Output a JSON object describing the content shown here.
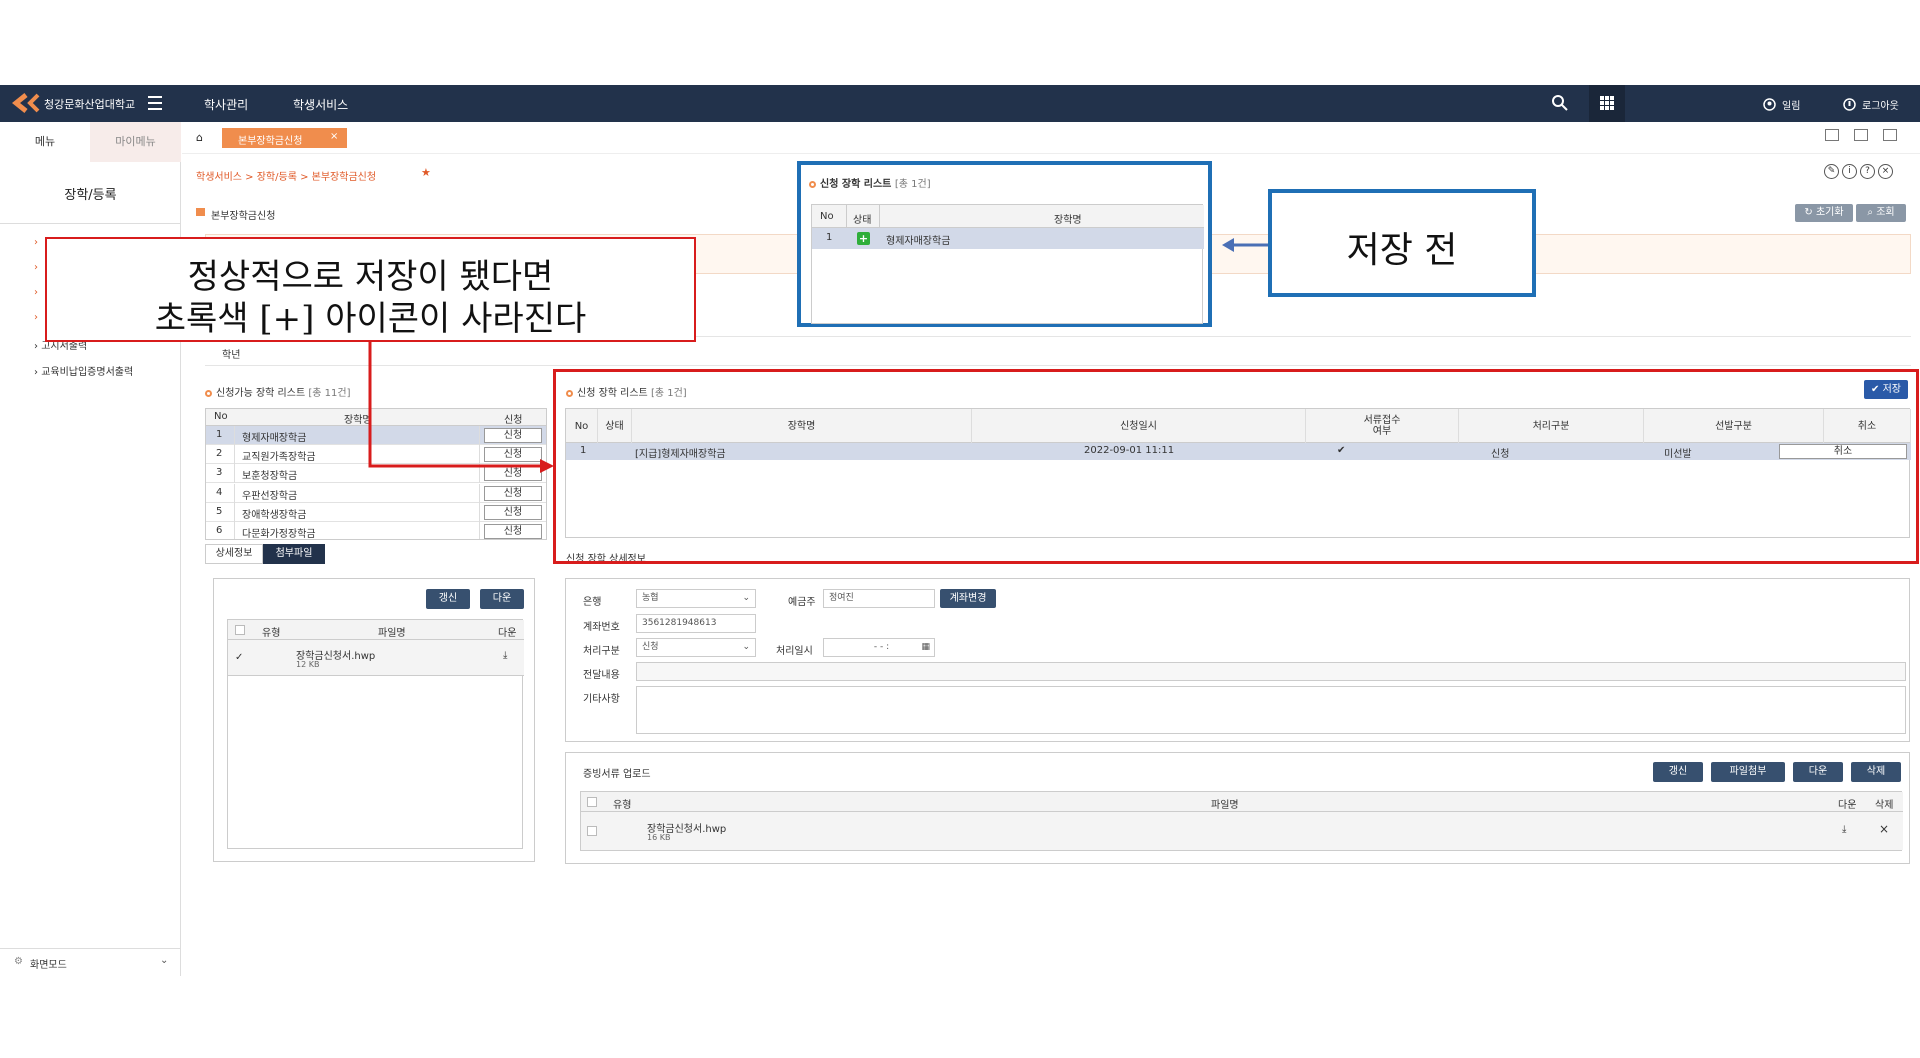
{
  "topbar": {
    "logo_text": "청강문화산업대학교",
    "menu1": "학사관리",
    "menu2": "학생서비스",
    "user": "일림",
    "logout": "로그아웃"
  },
  "sidebar": {
    "tab_menu": "메뉴",
    "tab_mymenu": "마이메뉴",
    "section_title": "장학/등록",
    "items": [
      "고지서출력",
      "교육비납입증명서출력"
    ],
    "screen_mode": "화면모드"
  },
  "main": {
    "active_tab": "본부장학금신청",
    "breadcrumb": "학생서비스 > 장학/등록 > 본부장학금신청",
    "page_title": "본부장학금신청",
    "btn_reset": "초기화",
    "btn_search": "조회",
    "grade_label": "학년",
    "available_list": {
      "title": "신청가능 장학 리스트",
      "count": "[총 11건]",
      "headers": [
        "No",
        "장학명",
        "신청"
      ],
      "rows": [
        {
          "no": "1",
          "name": "형제자매장학금",
          "action": "신청"
        },
        {
          "no": "2",
          "name": "교직원가족장학금",
          "action": "신청"
        },
        {
          "no": "3",
          "name": "보훈청장학금",
          "action": "신청"
        },
        {
          "no": "4",
          "name": "우판선장학금",
          "action": "신청"
        },
        {
          "no": "5",
          "name": "장애학생장학금",
          "action": "신청"
        },
        {
          "no": "6",
          "name": "다문화가정장학금",
          "action": "신청"
        }
      ]
    },
    "detail_tabs": [
      "상세정보",
      "첨부파일"
    ],
    "attach_left": {
      "btn_refresh": "갱신",
      "btn_down": "다운",
      "headers": [
        "유형",
        "파일명",
        "다운"
      ],
      "file_name": "장학금신청서.hwp",
      "file_size": "12 KB"
    },
    "applied_list": {
      "title": "신청 장학 리스트",
      "count": "[총 1건]",
      "btn_save": "저장",
      "headers": [
        "No",
        "상태",
        "장학명",
        "신청일시",
        "서류접수\n여부",
        "처리구분",
        "선발구분",
        "취소"
      ],
      "rows": [
        {
          "no": "1",
          "status": "",
          "name": "[지급]형제자매장학금",
          "date": "2022-09-01 11:11",
          "doc": "✔",
          "process": "신청",
          "select": "미선발",
          "cancel": "취소"
        }
      ]
    },
    "detail_label": "신청 장학 상세정보",
    "form": {
      "bank_label": "은행",
      "bank_value": "농협",
      "holder_label": "예금주",
      "holder_value": "정여진",
      "btn_account": "계좌변경",
      "account_label": "계좌번호",
      "account_value": "3561281948613",
      "process_label": "처리구분",
      "process_value": "신청",
      "process_date_label": "처리일시",
      "process_date_value": "- -  :",
      "deliver_label": "전달내용",
      "etc_label": "기타사항"
    },
    "upload": {
      "title": "증빙서류 업로드",
      "btn_refresh": "갱신",
      "btn_attach": "파일첨부",
      "btn_down": "다운",
      "btn_delete": "삭제",
      "headers": [
        "유형",
        "파일명",
        "다운",
        "삭제"
      ],
      "file_name": "장학금신청서.hwp",
      "file_size": "16 KB"
    }
  },
  "popup_before": {
    "title": "신청 장학 리스트",
    "count": "[총 1건]",
    "headers": [
      "No",
      "상태",
      "장학명"
    ],
    "row": {
      "no": "1",
      "name": "형제자매장학금"
    }
  },
  "annotations": {
    "before_label": "저장 전",
    "note_line1": "정상적으로 저장이 됐다면",
    "note_line2": "초록색 [+] 아이콘이 사라진다"
  },
  "colors": {
    "topbar": "#22324b",
    "accent_orange": "#f08d4d",
    "annotation_red": "#d81c1c",
    "annotation_blue": "#1f6fb5",
    "plus_green": "#2fae3a"
  }
}
